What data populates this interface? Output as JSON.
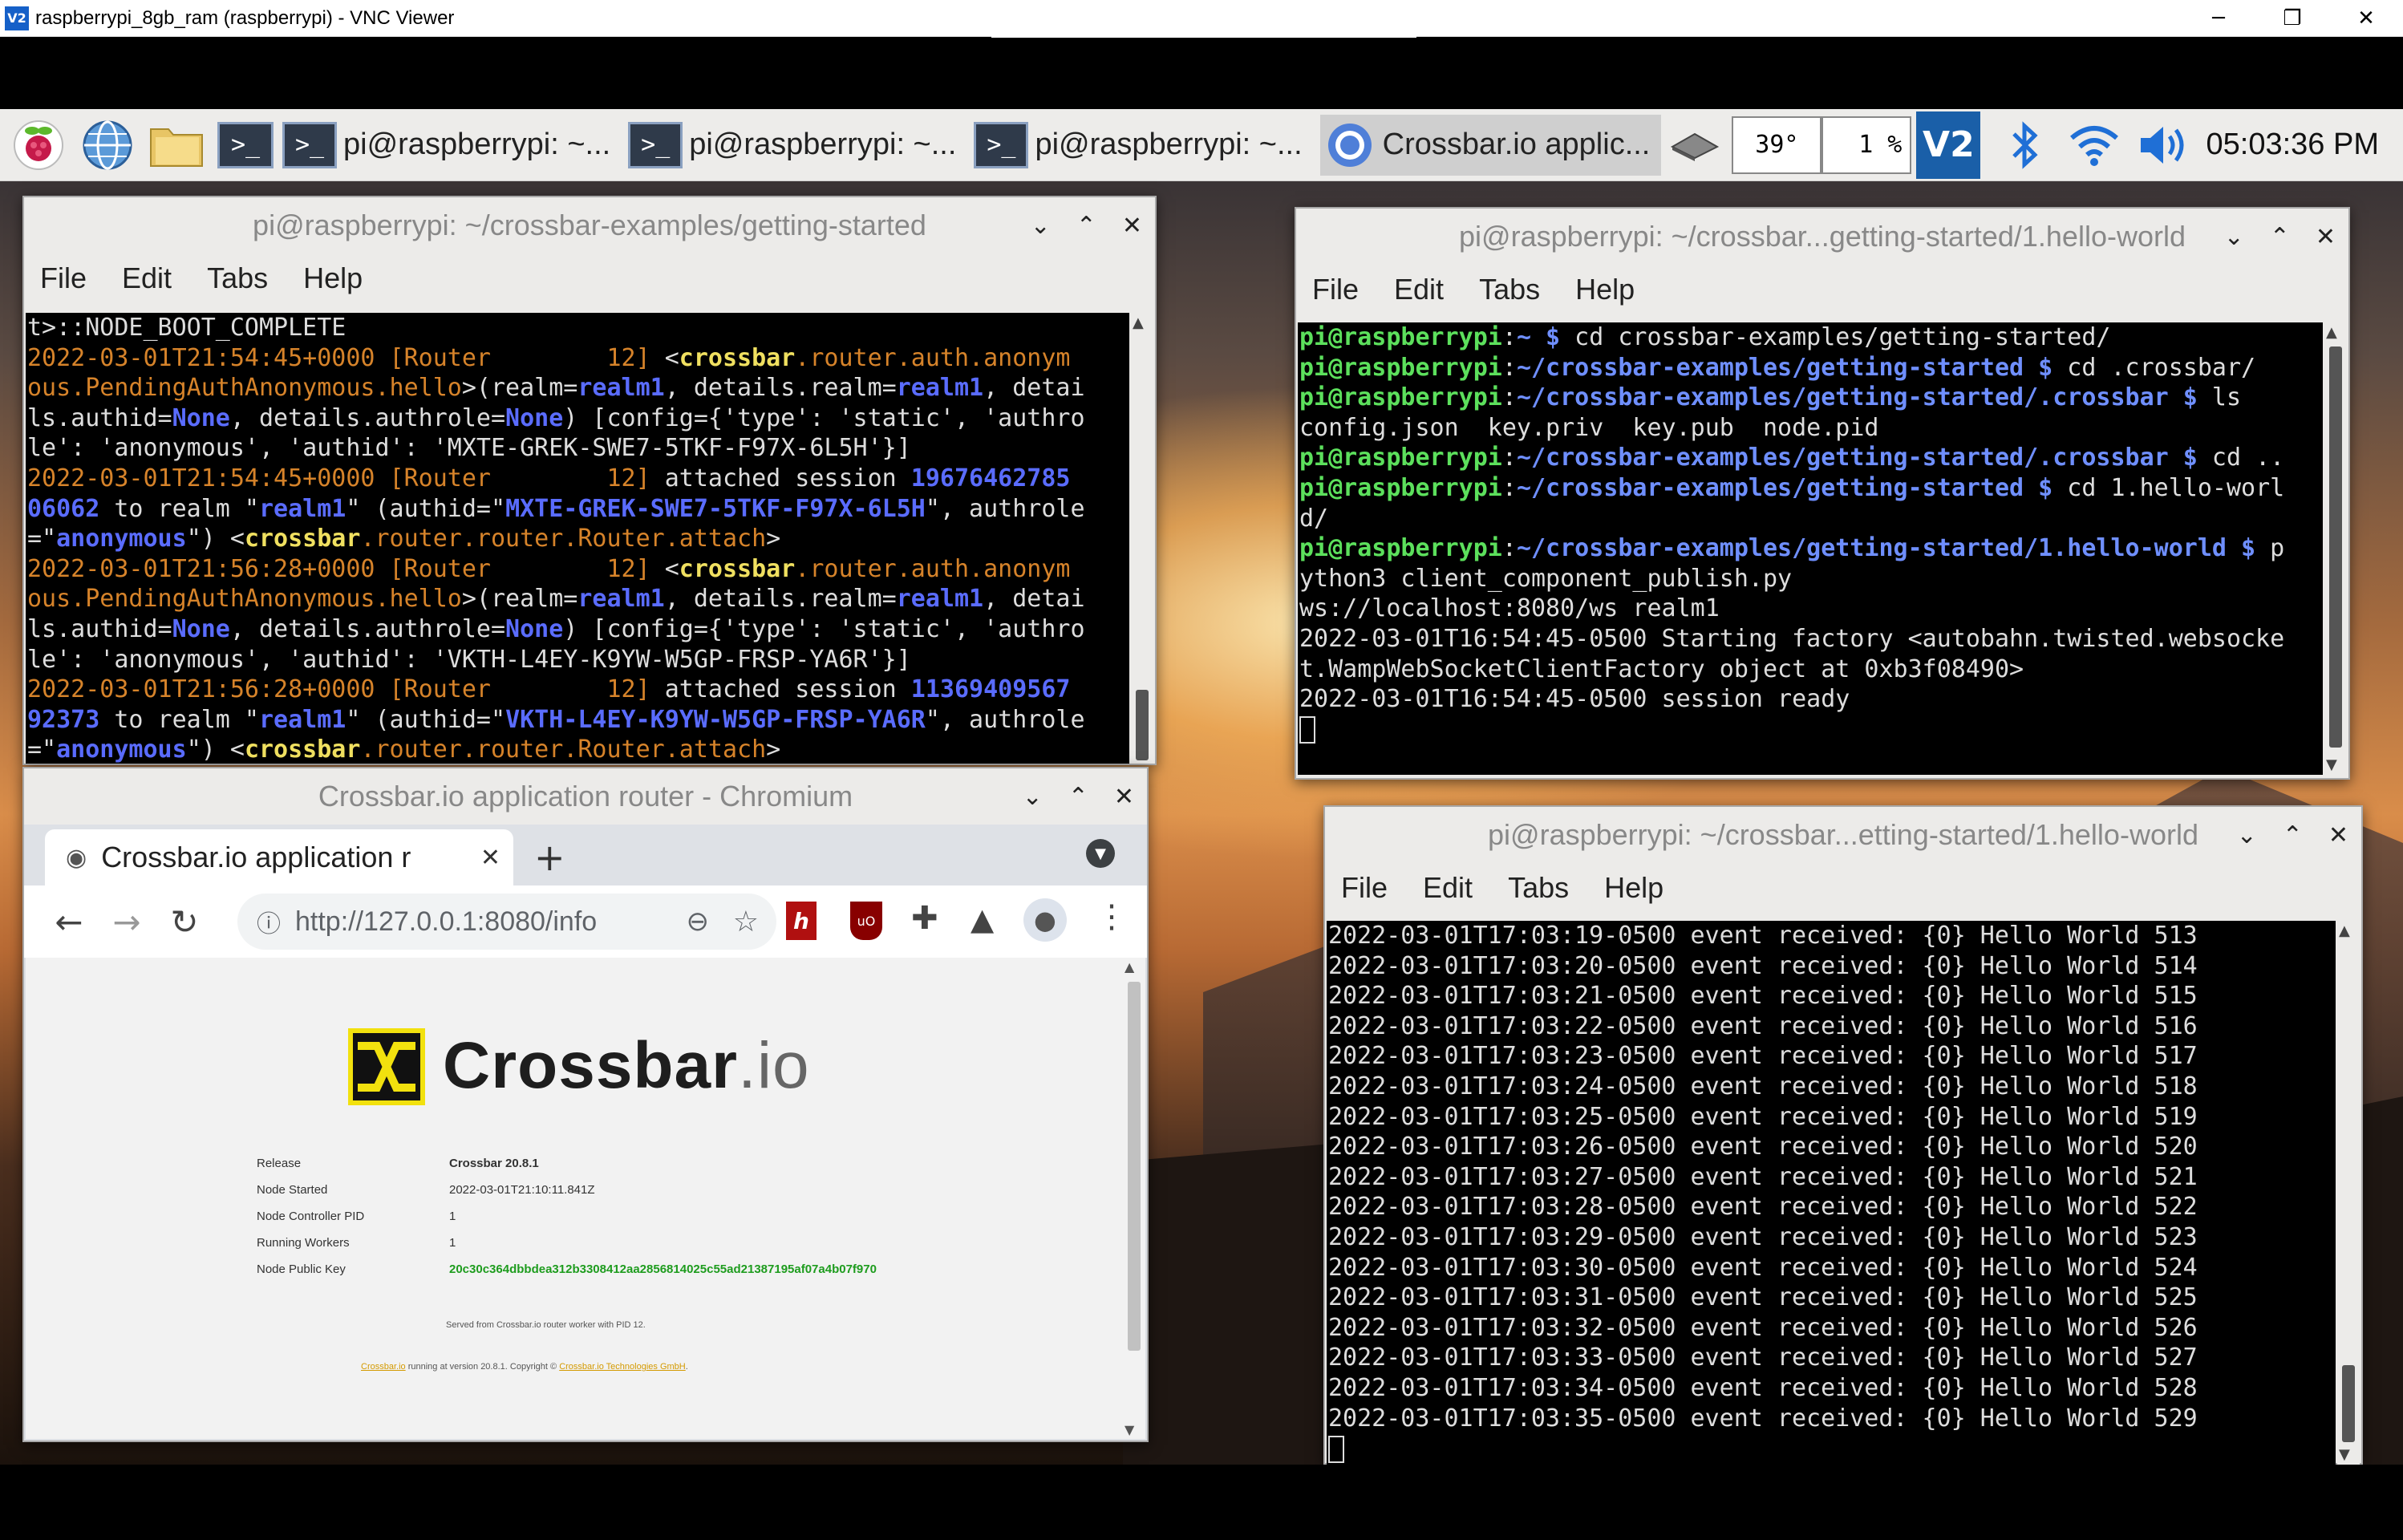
{
  "vnc": {
    "title": "raspberrypi_8gb_ram (raspberrypi) - VNC Viewer",
    "logo": "V2",
    "minimize": "─",
    "restore": "❐",
    "close": "✕"
  },
  "taskbar": {
    "tasks": [
      {
        "label": "pi@raspberrypi: ~...",
        "icon": "terminal-icon"
      },
      {
        "label": "pi@raspberrypi: ~...",
        "icon": "terminal-icon"
      },
      {
        "label": "pi@raspberrypi: ~...",
        "icon": "terminal-icon"
      },
      {
        "label": "Crossbar.io applic...",
        "icon": "chromium-icon"
      }
    ],
    "temperature": "39°",
    "cpu": "1 %",
    "clock": "05:03:36 PM"
  },
  "term1": {
    "title": "pi@raspberrypi: ~/crossbar-examples/getting-started",
    "menu": [
      "File",
      "Edit",
      "Tabs",
      "Help"
    ],
    "lines": [
      [
        [
          "w",
          "t>::NODE_BOOT_COMPLETE"
        ]
      ],
      [
        [
          "o",
          "2022-03-01T21:54:45+0000 [Router        12] "
        ],
        [
          "w",
          "<"
        ],
        [
          "y",
          "crossbar"
        ],
        [
          "o",
          ".router.auth.anonym"
        ]
      ],
      [
        [
          "o",
          "ous.PendingAuthAnonymous.hello"
        ],
        [
          "w",
          ">(realm="
        ],
        [
          "blu",
          "realm1"
        ],
        [
          "w",
          ", details.realm="
        ],
        [
          "blu",
          "realm1"
        ],
        [
          "w",
          ", detai"
        ]
      ],
      [
        [
          "w",
          "ls.authid="
        ],
        [
          "blu",
          "None"
        ],
        [
          "w",
          ", details.authrole="
        ],
        [
          "blu",
          "None"
        ],
        [
          "w",
          ") [config={'type': 'static', 'authro"
        ]
      ],
      [
        [
          "w",
          "le': 'anonymous', 'authid': 'MXTE-GREK-SWE7-5TKF-F97X-6L5H'}]"
        ]
      ],
      [
        [
          "o",
          "2022-03-01T21:54:45+0000 [Router        12] "
        ],
        [
          "w",
          "attached session "
        ],
        [
          "blu",
          "19676462785"
        ]
      ],
      [
        [
          "blu",
          "06062"
        ],
        [
          "w",
          " to realm \""
        ],
        [
          "blu",
          "realm1"
        ],
        [
          "w",
          "\" (authid=\""
        ],
        [
          "blu",
          "MXTE-GREK-SWE7-5TKF-F97X-6L5H"
        ],
        [
          "w",
          "\", authrole"
        ]
      ],
      [
        [
          "w",
          "=\""
        ],
        [
          "blu",
          "anonymous"
        ],
        [
          "w",
          "\") <"
        ],
        [
          "y",
          "crossbar"
        ],
        [
          "o",
          ".router.router.Router.attach"
        ],
        [
          "w",
          ">"
        ]
      ],
      [
        [
          "o",
          "2022-03-01T21:56:28+0000 [Router        12] "
        ],
        [
          "w",
          "<"
        ],
        [
          "y",
          "crossbar"
        ],
        [
          "o",
          ".router.auth.anonym"
        ]
      ],
      [
        [
          "o",
          "ous.PendingAuthAnonymous.hello"
        ],
        [
          "w",
          ">(realm="
        ],
        [
          "blu",
          "realm1"
        ],
        [
          "w",
          ", details.realm="
        ],
        [
          "blu",
          "realm1"
        ],
        [
          "w",
          ", detai"
        ]
      ],
      [
        [
          "w",
          "ls.authid="
        ],
        [
          "blu",
          "None"
        ],
        [
          "w",
          ", details.authrole="
        ],
        [
          "blu",
          "None"
        ],
        [
          "w",
          ") [config={'type': 'static', 'authro"
        ]
      ],
      [
        [
          "w",
          "le': 'anonymous', 'authid': 'VKTH-L4EY-K9YW-W5GP-FRSP-YA6R'}]"
        ]
      ],
      [
        [
          "o",
          "2022-03-01T21:56:28+0000 [Router        12] "
        ],
        [
          "w",
          "attached session "
        ],
        [
          "blu",
          "11369409567"
        ]
      ],
      [
        [
          "blu",
          "92373"
        ],
        [
          "w",
          " to realm \""
        ],
        [
          "blu",
          "realm1"
        ],
        [
          "w",
          "\" (authid=\""
        ],
        [
          "blu",
          "VKTH-L4EY-K9YW-W5GP-FRSP-YA6R"
        ],
        [
          "w",
          "\", authrole"
        ]
      ],
      [
        [
          "w",
          "=\""
        ],
        [
          "blu",
          "anonymous"
        ],
        [
          "w",
          "\") <"
        ],
        [
          "y",
          "crossbar"
        ],
        [
          "o",
          ".router.router.Router.attach"
        ],
        [
          "w",
          ">"
        ]
      ]
    ]
  },
  "term2": {
    "title": "pi@raspberrypi: ~/crossbar...getting-started/1.hello-world",
    "menu": [
      "File",
      "Edit",
      "Tabs",
      "Help"
    ],
    "lines": [
      [
        [
          "g",
          "pi@raspberrypi"
        ],
        [
          "w",
          ":"
        ],
        [
          "b",
          "~ $"
        ],
        [
          "w",
          " cd crossbar-examples/getting-started/"
        ]
      ],
      [
        [
          "g",
          "pi@raspberrypi"
        ],
        [
          "w",
          ":"
        ],
        [
          "b",
          "~/crossbar-examples/getting-started $"
        ],
        [
          "w",
          " cd .crossbar/"
        ]
      ],
      [
        [
          "g",
          "pi@raspberrypi"
        ],
        [
          "w",
          ":"
        ],
        [
          "b",
          "~/crossbar-examples/getting-started/.crossbar $"
        ],
        [
          "w",
          " ls"
        ]
      ],
      [
        [
          "w",
          "config.json  key.priv  key.pub  node.pid"
        ]
      ],
      [
        [
          "g",
          "pi@raspberrypi"
        ],
        [
          "w",
          ":"
        ],
        [
          "b",
          "~/crossbar-examples/getting-started/.crossbar $"
        ],
        [
          "w",
          " cd .."
        ]
      ],
      [
        [
          "g",
          "pi@raspberrypi"
        ],
        [
          "w",
          ":"
        ],
        [
          "b",
          "~/crossbar-examples/getting-started $"
        ],
        [
          "w",
          " cd 1.hello-worl"
        ]
      ],
      [
        [
          "w",
          "d/"
        ]
      ],
      [
        [
          "g",
          "pi@raspberrypi"
        ],
        [
          "w",
          ":"
        ],
        [
          "b",
          "~/crossbar-examples/getting-started/1.hello-world $"
        ],
        [
          "w",
          " p"
        ]
      ],
      [
        [
          "w",
          "ython3 client_component_publish.py"
        ]
      ],
      [
        [
          "w",
          "ws://localhost:8080/ws realm1"
        ]
      ],
      [
        [
          "w",
          "2022-03-01T16:54:45-0500 Starting factory <autobahn.twisted.websocke"
        ]
      ],
      [
        [
          "w",
          "t.WampWebSocketClientFactory object at 0xb3f08490>"
        ]
      ],
      [
        [
          "w",
          "2022-03-01T16:54:45-0500 session ready"
        ]
      ]
    ]
  },
  "term3": {
    "title": "pi@raspberrypi: ~/crossbar...etting-started/1.hello-world",
    "menu": [
      "File",
      "Edit",
      "Tabs",
      "Help"
    ],
    "lines": [
      "2022-03-01T17:03:19-0500 event received: {0} Hello World 513",
      "2022-03-01T17:03:20-0500 event received: {0} Hello World 514",
      "2022-03-01T17:03:21-0500 event received: {0} Hello World 515",
      "2022-03-01T17:03:22-0500 event received: {0} Hello World 516",
      "2022-03-01T17:03:23-0500 event received: {0} Hello World 517",
      "2022-03-01T17:03:24-0500 event received: {0} Hello World 518",
      "2022-03-01T17:03:25-0500 event received: {0} Hello World 519",
      "2022-03-01T17:03:26-0500 event received: {0} Hello World 520",
      "2022-03-01T17:03:27-0500 event received: {0} Hello World 521",
      "2022-03-01T17:03:28-0500 event received: {0} Hello World 522",
      "2022-03-01T17:03:29-0500 event received: {0} Hello World 523",
      "2022-03-01T17:03:30-0500 event received: {0} Hello World 524",
      "2022-03-01T17:03:31-0500 event received: {0} Hello World 525",
      "2022-03-01T17:03:32-0500 event received: {0} Hello World 526",
      "2022-03-01T17:03:33-0500 event received: {0} Hello World 527",
      "2022-03-01T17:03:34-0500 event received: {0} Hello World 528",
      "2022-03-01T17:03:35-0500 event received: {0} Hello World 529"
    ]
  },
  "chromium": {
    "title": "Crossbar.io application router - Chromium",
    "tab_label": "Crossbar.io application r",
    "new_tab": "+",
    "url": "http://127.0.0.1:8080/info",
    "logo_main": "Crossbar",
    "logo_suffix": ".io",
    "info": [
      {
        "key": "Release",
        "value": "Crossbar 20.8.1"
      },
      {
        "key": "Node Started",
        "value": "2022-03-01T21:10:11.841Z"
      },
      {
        "key": "Node Controller PID",
        "value": "1"
      },
      {
        "key": "Running Workers",
        "value": "1"
      },
      {
        "key": "Node Public Key",
        "value": "20c30c364dbbdea312b3308412aa2856814025c55ad21387195af07a4b07f970"
      }
    ],
    "served": "Served from Crossbar.io router worker with PID 12.",
    "footer_link1": "Crossbar.io",
    "footer_mid": " running at version 20.8.1. Copyright © ",
    "footer_link2": "Crossbar.io Technologies GmbH",
    "footer_end": "."
  },
  "colors": {
    "crossbar_yellow": "#f2e10e",
    "key_green": "#1e9c1e",
    "link_orange": "#d49a00"
  }
}
